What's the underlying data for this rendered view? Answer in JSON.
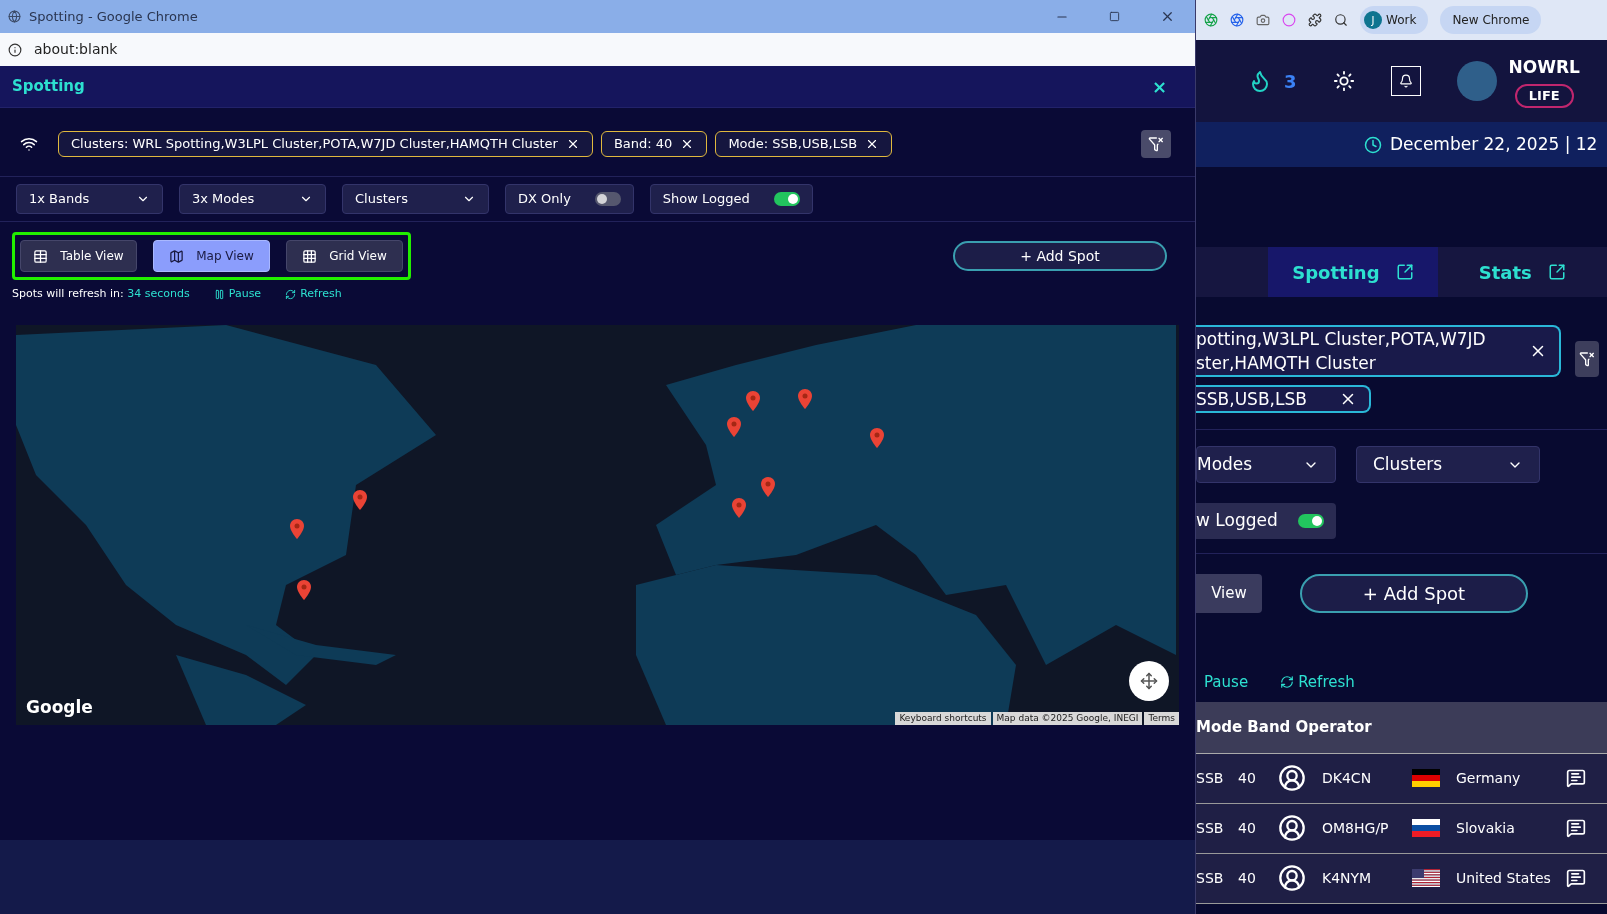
{
  "popup": {
    "title": "Spotting - Google Chrome",
    "url": "about:blank"
  },
  "panel": {
    "title": "Spotting",
    "close": "×"
  },
  "filters": [
    {
      "label": "Clusters: WRL Spotting,W3LPL Cluster,POTA,W7JD Cluster,HAMQTH Cluster"
    },
    {
      "label": "Band: 40"
    },
    {
      "label": "Mode: SSB,USB,LSB"
    }
  ],
  "controls": [
    {
      "kind": "select",
      "label": "1x Bands"
    },
    {
      "kind": "select",
      "label": "3x Modes"
    },
    {
      "kind": "select",
      "label": "Clusters"
    },
    {
      "kind": "toggle",
      "label": "DX Only",
      "on": false
    },
    {
      "kind": "toggle",
      "label": "Show Logged",
      "on": true
    }
  ],
  "views": [
    {
      "label": "Table View",
      "kind": "table",
      "selected": false
    },
    {
      "label": "Map View",
      "kind": "map",
      "selected": true
    },
    {
      "label": "Grid View",
      "kind": "grid",
      "selected": false
    }
  ],
  "add_spot": "+ Add Spot",
  "refresh": {
    "prefix": "Spots will refresh in:",
    "seconds": "34 seconds",
    "pause": "Pause",
    "refresh": "Refresh"
  },
  "map": {
    "logo": "Google",
    "attribution": [
      "Keyboard shortcuts",
      "Map data ©2025 Google, INEGI",
      "Terms"
    ]
  },
  "background_app": {
    "toolbar": {
      "profile_initial": "J",
      "profile": "Work",
      "new_chrome": "New Chrome"
    },
    "streak": "3",
    "callsign": "NOWRL",
    "badge": "LIFE",
    "date": "December 22, 2025 | 12",
    "tabs": [
      {
        "label": "Spotting",
        "selected": true
      },
      {
        "label": "Stats",
        "selected": false
      }
    ],
    "chips": [
      {
        "lines": [
          "potting,W3LPL Cluster,POTA,W7JD",
          "ster,HAMQTH Cluster"
        ]
      },
      {
        "lines": [
          "SSB,USB,LSB"
        ]
      }
    ],
    "selects": [
      "Modes",
      "Clusters"
    ],
    "toggle": {
      "label": "w Logged",
      "on": true
    },
    "view_button": "View",
    "add_spot": "+ Add Spot",
    "pause": "Pause",
    "refresh": "Refresh",
    "table_header": "Mode Band Operator",
    "rows": [
      {
        "mode": "SSB",
        "band": "40",
        "operator": "DK4CN",
        "kind": "de",
        "country": "Germany"
      },
      {
        "mode": "SSB",
        "band": "40",
        "operator": "OM8HG/P",
        "kind": "sk",
        "country": "Slovakia"
      },
      {
        "mode": "SSB",
        "band": "40",
        "operator": "K4NYM",
        "kind": "us",
        "country": "United States"
      }
    ]
  }
}
